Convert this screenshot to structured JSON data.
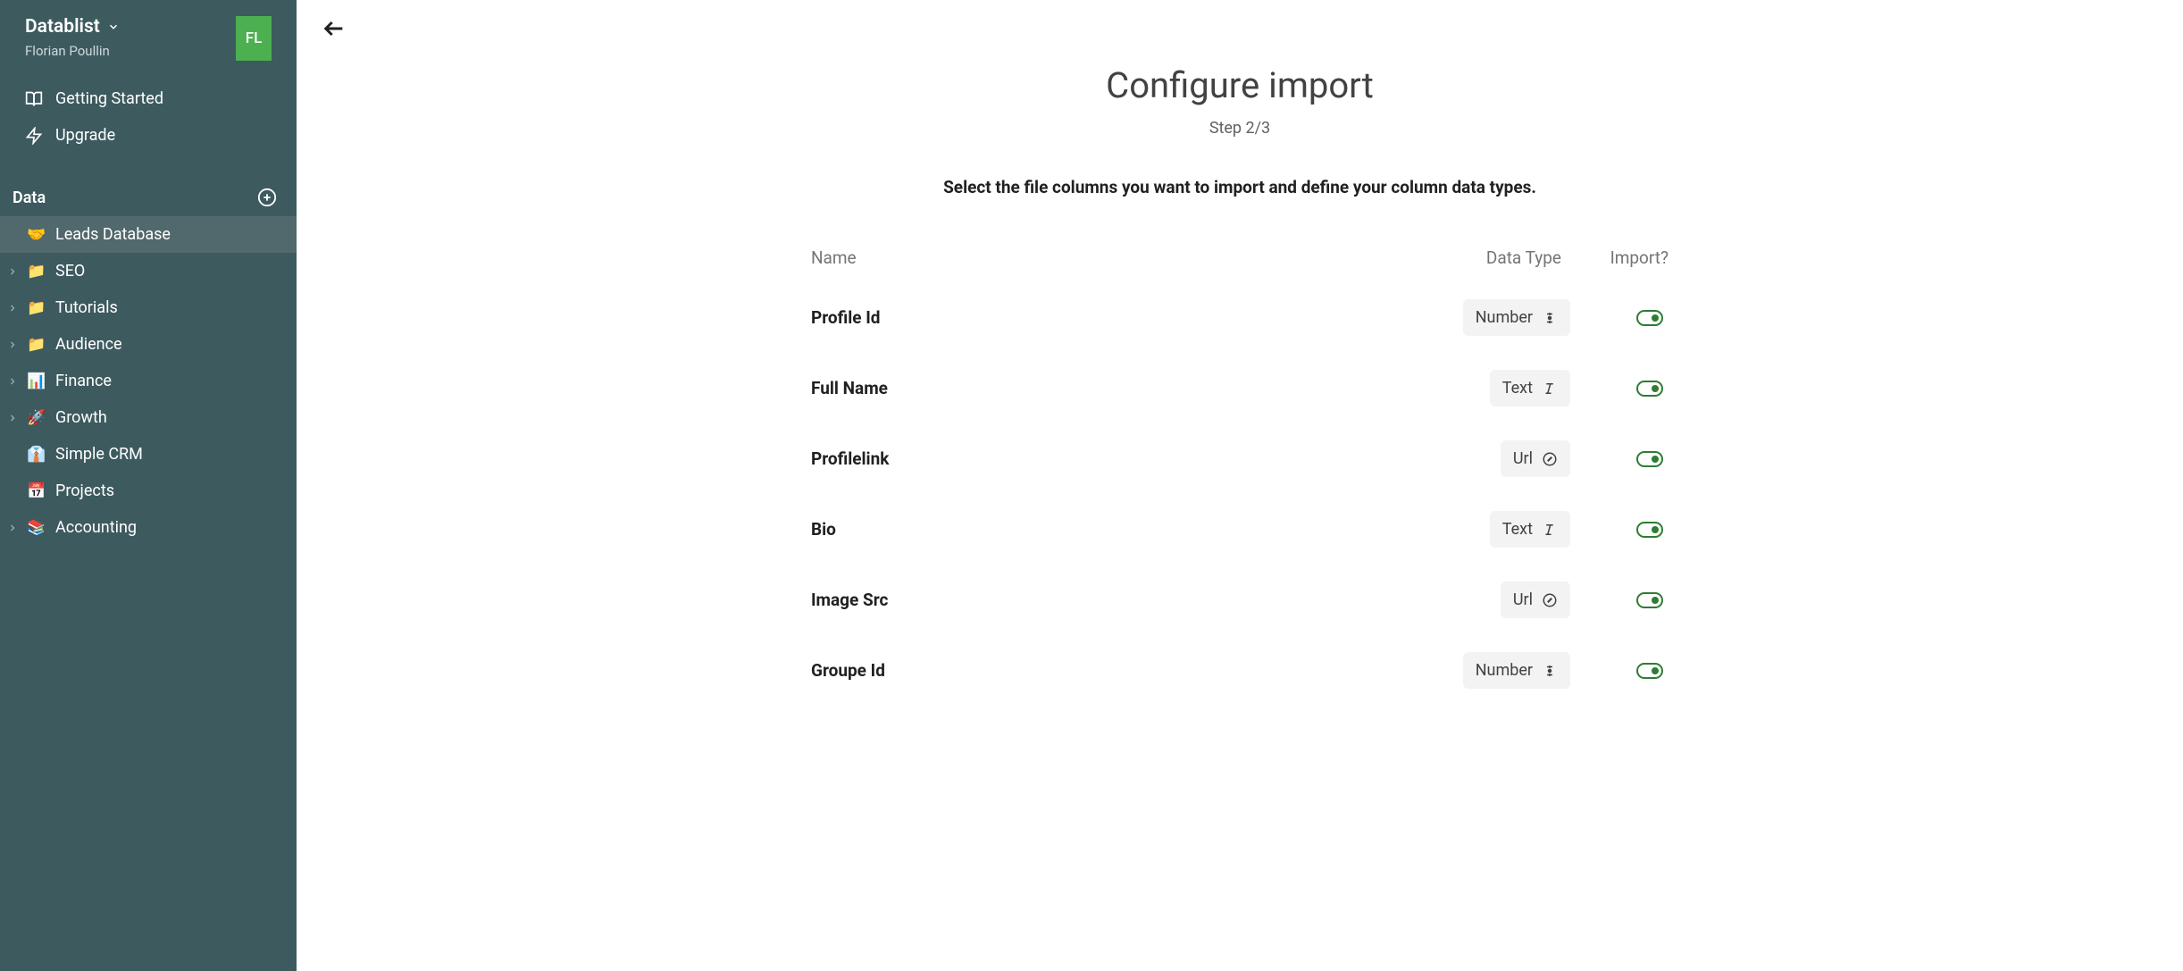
{
  "sidebar": {
    "brand": "Datablist",
    "username": "Florian Poullin",
    "avatar": "FL",
    "nav": {
      "getting_started": "Getting Started",
      "upgrade": "Upgrade"
    },
    "section_title": "Data",
    "items": [
      {
        "emoji": "🤝",
        "label": "Leads Database",
        "active": true,
        "has_children": false
      },
      {
        "emoji": "📁",
        "label": "SEO",
        "active": false,
        "has_children": true
      },
      {
        "emoji": "📁",
        "label": "Tutorials",
        "active": false,
        "has_children": true
      },
      {
        "emoji": "📁",
        "label": "Audience",
        "active": false,
        "has_children": true
      },
      {
        "emoji": "📊",
        "label": "Finance",
        "active": false,
        "has_children": true
      },
      {
        "emoji": "🚀",
        "label": "Growth",
        "active": false,
        "has_children": true
      },
      {
        "emoji": "👔",
        "label": "Simple CRM",
        "active": false,
        "has_children": false
      },
      {
        "emoji": "📅",
        "label": "Projects",
        "active": false,
        "has_children": false
      },
      {
        "emoji": "📚",
        "label": "Accounting",
        "active": false,
        "has_children": true
      }
    ]
  },
  "main": {
    "title": "Configure import",
    "step": "Step 2/3",
    "prompt": "Select the file columns you want to import and define your column data types.",
    "headers": {
      "name": "Name",
      "type": "Data Type",
      "import": "Import?"
    },
    "rows": [
      {
        "name": "Profile Id",
        "type": "Number",
        "type_icon": "number",
        "import": true
      },
      {
        "name": "Full Name",
        "type": "Text",
        "type_icon": "text",
        "import": true
      },
      {
        "name": "Profilelink",
        "type": "Url",
        "type_icon": "url",
        "import": true
      },
      {
        "name": "Bio",
        "type": "Text",
        "type_icon": "text",
        "import": true
      },
      {
        "name": "Image Src",
        "type": "Url",
        "type_icon": "url",
        "import": true
      },
      {
        "name": "Groupe Id",
        "type": "Number",
        "type_icon": "number",
        "import": true
      }
    ]
  }
}
